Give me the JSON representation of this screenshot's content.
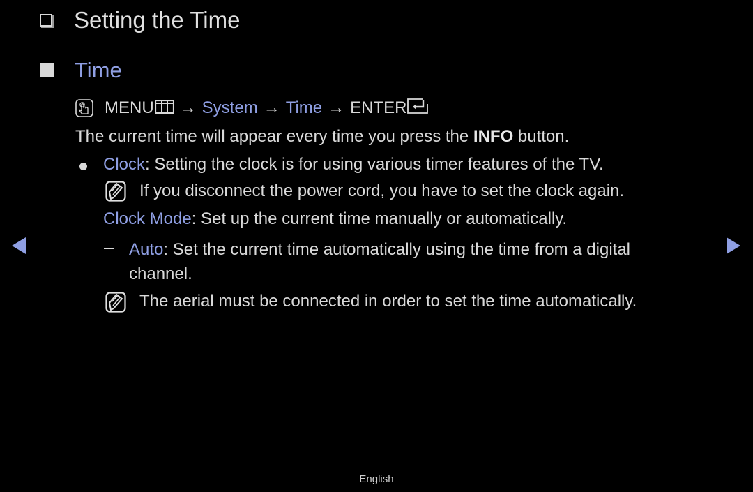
{
  "page": {
    "title": "Setting the Time",
    "section_title": "Time",
    "menu_path": {
      "icon": "hand-pointer-icon",
      "menu_label": "MENU",
      "menu_icon": "menu-grid-icon",
      "arrow": "→",
      "steps": [
        "System",
        "Time"
      ],
      "enter_label": "ENTER",
      "enter_icon": "enter-return-icon"
    },
    "intro": {
      "before": "The current time will appear every time you press the ",
      "bold": "INFO",
      "after": " button."
    },
    "clock": {
      "bullet_icon": "bullet-icon",
      "term": "Clock",
      "desc": ": Setting the clock is for using various timer features of the TV."
    },
    "clock_note": {
      "icon": "note-icon",
      "text": "If you disconnect the power cord, you have to set the clock again."
    },
    "clock_mode": {
      "term": "Clock Mode",
      "desc": ": Set up the current time manually or automatically."
    },
    "auto": {
      "term": "Auto",
      "desc_line1": ": Set the current time automatically using the time from a digital",
      "desc_line2": "channel."
    },
    "auto_note": {
      "icon": "note-icon",
      "text": "The aerial must be connected in order to set the time automatically."
    },
    "navigation": {
      "prev_icon": "triangle-left-icon",
      "next_icon": "triangle-right-icon"
    },
    "footer": {
      "language": "English"
    },
    "colors": {
      "accent": "#8f9fe3",
      "text": "#d9d9d9",
      "background": "#000000"
    }
  }
}
